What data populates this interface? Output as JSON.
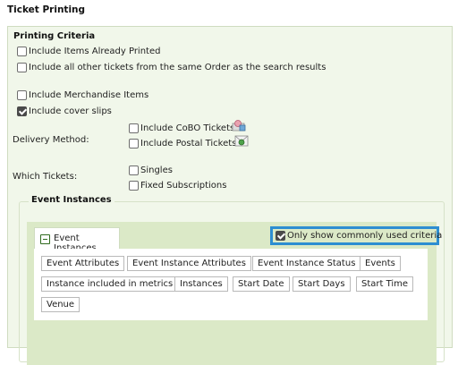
{
  "page": {
    "title": "Ticket Printing"
  },
  "criteria": {
    "heading": "Printing Criteria",
    "options": [
      {
        "label": "Include Items Already Printed",
        "checked": false
      },
      {
        "label": "Include all other tickets from the same Order as the search results",
        "checked": false
      },
      {
        "label": "Include Merchandise Items",
        "checked": false
      },
      {
        "label": "Include cover slips",
        "checked": true
      }
    ],
    "delivery": {
      "label": "Delivery Method:",
      "options": [
        {
          "label": "Include CoBO Tickets",
          "checked": false,
          "icon": "cobo-ticket-icon"
        },
        {
          "label": "Include Postal Tickets",
          "checked": false,
          "icon": "postal-ticket-icon"
        }
      ]
    },
    "which_tickets": {
      "label": "Which Tickets:",
      "options": [
        {
          "label": "Singles",
          "checked": false
        },
        {
          "label": "Fixed Subscriptions",
          "checked": false
        }
      ]
    }
  },
  "event_instances": {
    "legend": "Event Instances",
    "tab_label": "Event Instances",
    "only_common": {
      "label": "Only show commonly used criteria",
      "checked": true
    },
    "tags": [
      "Event Attributes",
      "Event Instance Attributes",
      "Event Instance Status",
      "Events",
      "Instance included in metrics",
      "Instances",
      "Start Date",
      "Start Days",
      "Start Time",
      "Venue"
    ]
  },
  "colors": {
    "panel_bg": "#f1f7ea",
    "inner_bg": "#dbe9c7",
    "highlight_border": "#2d8ed1",
    "minus_icon": "#2f6b1e"
  }
}
